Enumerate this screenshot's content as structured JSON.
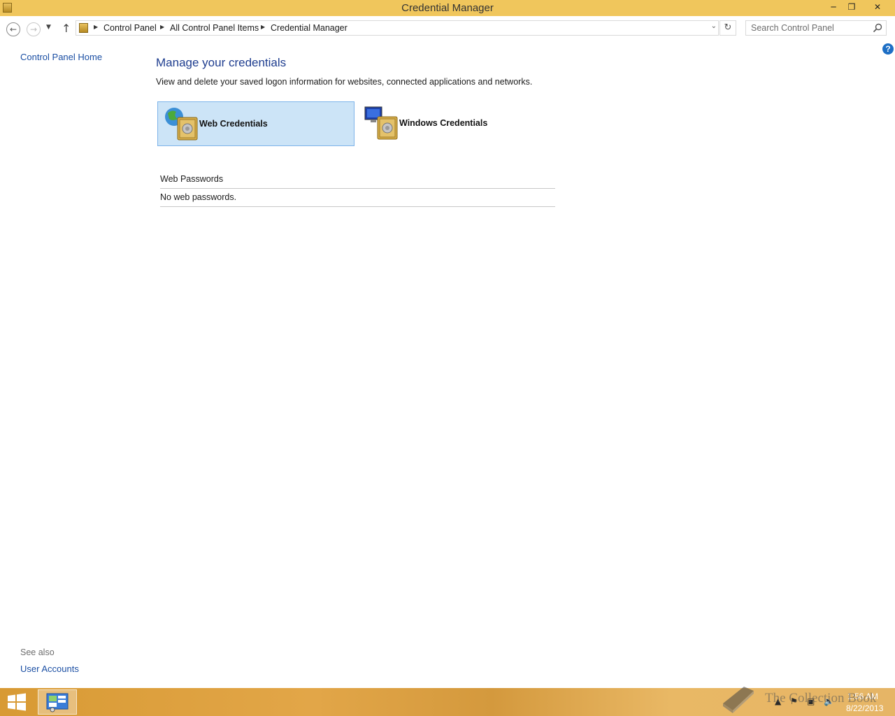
{
  "window": {
    "title": "Credential Manager",
    "controls": {
      "minimize": "─",
      "maximize": "❐",
      "close": "✕"
    }
  },
  "nav": {
    "back_icon": "←",
    "forward_icon": "→",
    "recent_icon": "▼",
    "up_icon": "↑",
    "breadcrumb": [
      "Control Panel",
      "All Control Panel Items",
      "Credential Manager"
    ],
    "dropdown_icon": "⌄",
    "refresh_icon": "↻",
    "search_placeholder": "Search Control Panel"
  },
  "help": {
    "label": "?"
  },
  "left_pane": {
    "home_link": "Control Panel Home",
    "see_also": "See also",
    "links": [
      "User Accounts"
    ]
  },
  "main": {
    "title": "Manage your credentials",
    "description": "View and delete your saved logon information for websites, connected applications and networks.",
    "tiles": [
      {
        "label": "Web Credentials",
        "selected": true,
        "icon": "globe-vault-icon"
      },
      {
        "label": "Windows Credentials",
        "selected": false,
        "icon": "computer-vault-icon"
      }
    ],
    "section_header": "Web Passwords",
    "empty_message": "No web passwords."
  },
  "taskbar": {
    "time": "1:56 AM",
    "date": "8/22/2013",
    "watermark": "The Collection Book",
    "tray_icons": [
      "show-hidden-icon",
      "flag-icon",
      "network-icon",
      "volume-icon"
    ]
  },
  "colors": {
    "titlebar": "#f0c65c",
    "accent_link": "#1a4ea3",
    "heading": "#1e3d8f",
    "tile_selected_bg": "#cce4f7",
    "tile_selected_border": "#7eb4ea"
  }
}
